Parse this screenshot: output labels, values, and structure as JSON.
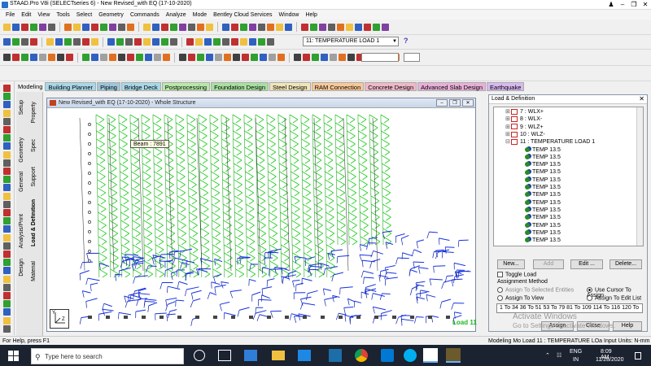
{
  "app": {
    "title": "STAAD.Pro V8i (SELECTseries 6) - New Revised_with EQ (17-10-2020)"
  },
  "menu": [
    "File",
    "Edit",
    "View",
    "Tools",
    "Select",
    "Geometry",
    "Commands",
    "Analyze",
    "Mode",
    "Bentley Cloud Services",
    "Window",
    "Help"
  ],
  "toolbar": {
    "load_case_select": "11: TEMPERATURE LOAD 1"
  },
  "tabs": {
    "mode_label": "Modeling",
    "items": [
      {
        "label": "Building Planner",
        "color": "#a8d8e8"
      },
      {
        "label": "Piping",
        "color": "#9cc8dc"
      },
      {
        "label": "Bridge Deck",
        "color": "#a8d8e8"
      },
      {
        "label": "Postprocessing",
        "color": "#b8e8a8"
      },
      {
        "label": "Foundation Design",
        "color": "#a8e0a0"
      },
      {
        "label": "Steel Design",
        "color": "#f0e4b8"
      },
      {
        "label": "RAM Connection",
        "color": "#f8c898"
      },
      {
        "label": "Concrete Design",
        "color": "#f0b8c8"
      },
      {
        "label": "Advanced Slab Design",
        "color": "#e8b0d8"
      },
      {
        "label": "Earthquake",
        "color": "#d8b8f0"
      }
    ]
  },
  "side_tabs": [
    "Setup",
    "Geometry",
    "General",
    "Analysis/Print",
    "Design"
  ],
  "side_subtabs": [
    "Property",
    "Spec",
    "Support",
    "Load & Definition",
    "Material"
  ],
  "viewport": {
    "title": "New Revised_with EQ (17-10-2020) - Whole Structure",
    "tooltip": "Beam : 7891",
    "load_label": "Load 11"
  },
  "panel": {
    "title": "Load & Definition",
    "tree": [
      {
        "label": "7 : WLX+",
        "type": "load"
      },
      {
        "label": "8 : WLX-",
        "type": "load"
      },
      {
        "label": "9 : WLZ+",
        "type": "load"
      },
      {
        "label": "10 : WLZ-",
        "type": "load"
      },
      {
        "label": "11 : TEMPERATURE LOAD 1",
        "type": "load"
      },
      {
        "label": "TEMP 13.5",
        "type": "temp"
      },
      {
        "label": "TEMP 13.5",
        "type": "temp"
      },
      {
        "label": "TEMP 13.5",
        "type": "temp"
      },
      {
        "label": "TEMP 13.5",
        "type": "temp"
      },
      {
        "label": "TEMP 13.5",
        "type": "temp"
      },
      {
        "label": "TEMP 13.5",
        "type": "temp"
      },
      {
        "label": "TEMP 13.5",
        "type": "temp"
      },
      {
        "label": "TEMP 13.5",
        "type": "temp"
      },
      {
        "label": "TEMP 13.5",
        "type": "temp"
      },
      {
        "label": "TEMP 13.5",
        "type": "temp"
      },
      {
        "label": "TEMP 13.5",
        "type": "temp"
      },
      {
        "label": "TEMP 13.5",
        "type": "temp"
      },
      {
        "label": "TEMP 13.5",
        "type": "temp"
      }
    ],
    "new_btn": "New...",
    "add_btn": "Add",
    "edit_btn": "Edit ...",
    "delete_btn": "Delete...",
    "toggle_load": "Toggle Load",
    "assignment_method": "Assignment Method",
    "assign_selected": "Assign To Selected Entities",
    "use_cursor": "Use Cursor To Assign",
    "assign_view": "Assign To View",
    "assign_edit_list": "Assign To Edit List",
    "assign_list": "1 To 34 36 To 51 53 To 79 81 To 109 114 To 116 120 To",
    "assign_btn": "Assign",
    "close_btn": "Close",
    "help_btn": "Help"
  },
  "watermark": {
    "line1": "Activate Windows",
    "line2": "Go to Settings to activate Windows."
  },
  "status": {
    "left": "For Help, press F1",
    "right": "Modeling Mo  Load 11 : TEMPERATURE LOa Input Units:  N-mm"
  },
  "taskbar": {
    "search_placeholder": "Type here to search",
    "lang": "ENG",
    "region": "IN",
    "time": "8:09 AM",
    "date": "11/28/2020"
  }
}
